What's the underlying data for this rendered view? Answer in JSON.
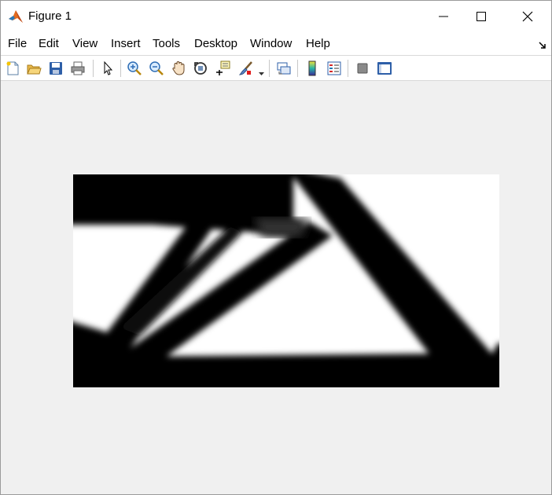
{
  "window": {
    "title": "Figure 1"
  },
  "titlebar": {
    "app_icon": "matlab-logo-icon",
    "controls": [
      "minimize-icon",
      "maximize-icon",
      "close-icon"
    ]
  },
  "menubar": {
    "items": [
      "File",
      "Edit",
      "View",
      "Insert",
      "Tools",
      "Desktop",
      "Window",
      "Help"
    ],
    "dock_icon": "dock-arrow-icon"
  },
  "toolbar": {
    "tools": [
      "new-figure-icon",
      "open-file-icon",
      "save-icon",
      "print-icon",
      "select-arrow-icon",
      "zoom-in-icon",
      "zoom-out-icon",
      "pan-hand-icon",
      "rotate-3d-icon",
      "data-cursor-icon",
      "brush-icon",
      "link-plot-icon",
      "insert-colorbar-icon",
      "insert-legend-icon",
      "hide-plot-tools-icon",
      "show-plot-tools-icon"
    ]
  },
  "figure": {
    "content": "grayscale topology optimization image",
    "colormap": [
      "#000000",
      "#ffffff"
    ]
  }
}
